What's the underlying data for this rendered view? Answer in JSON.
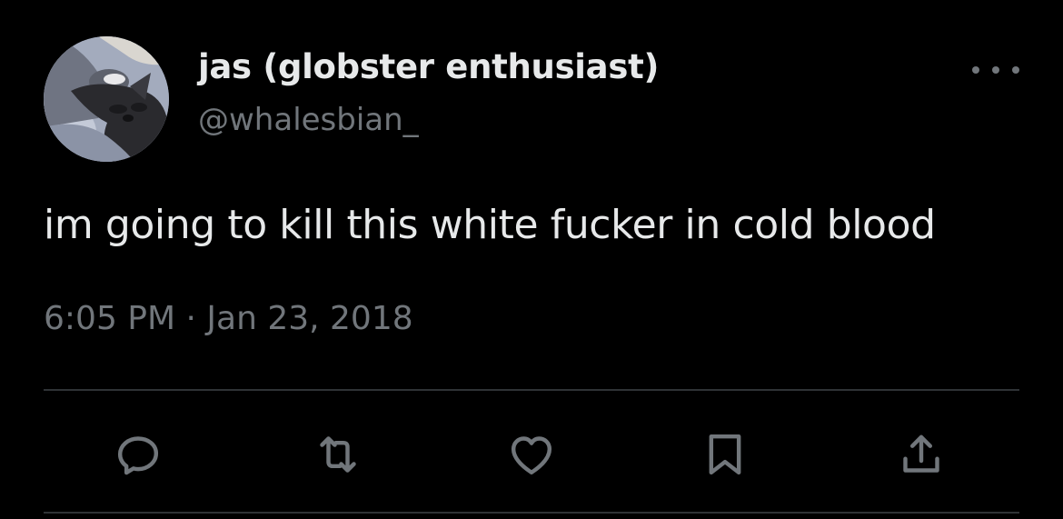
{
  "tweet": {
    "author": {
      "display_name": "jas (globster enthusiast)",
      "handle": "@whalesbian_"
    },
    "text": "im going to kill this white fucker in cold blood",
    "timestamp": "6:05 PM · Jan 23, 2018"
  },
  "actions": {
    "reply_icon": "reply-icon",
    "retweet_icon": "retweet-icon",
    "like_icon": "heart-icon",
    "bookmark_icon": "bookmark-icon",
    "share_icon": "share-icon"
  },
  "colors": {
    "background": "#000000",
    "primary_text": "#e7e9ea",
    "secondary_text": "#71767b",
    "divider": "#2f3336"
  }
}
